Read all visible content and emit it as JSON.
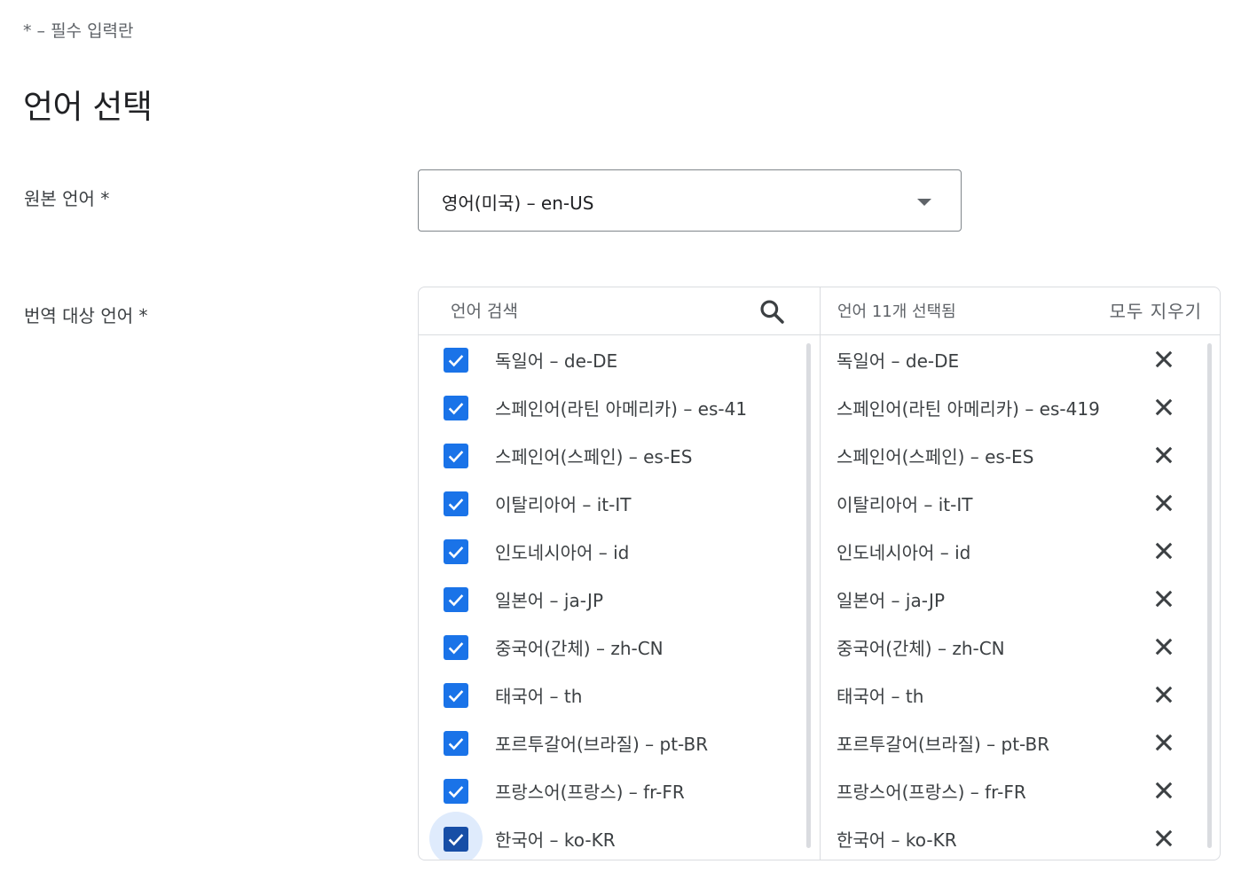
{
  "required_note": "* – 필수 입력란",
  "section_title": "언어 선택",
  "source": {
    "label": "원본 언어 *",
    "value": "영어(미국) – en-US"
  },
  "target": {
    "label": "번역 대상 언어 *",
    "search_placeholder": "언어 검색",
    "selected_count": "언어 11개 선택됨",
    "clear_all": "모두 지우기",
    "options": [
      {
        "label": "독일어 – de-DE",
        "checked": true
      },
      {
        "label": "스페인어(라틴 아메리카) – es-41",
        "checked": true
      },
      {
        "label": "스페인어(스페인) – es-ES",
        "checked": true
      },
      {
        "label": "이탈리아어 – it-IT",
        "checked": true
      },
      {
        "label": "인도네시아어 – id",
        "checked": true
      },
      {
        "label": "일본어 – ja-JP",
        "checked": true
      },
      {
        "label": "중국어(간체) – zh-CN",
        "checked": true
      },
      {
        "label": "태국어 – th",
        "checked": true
      },
      {
        "label": "포르투갈어(브라질) – pt-BR",
        "checked": true
      },
      {
        "label": "프랑스어(프랑스) – fr-FR",
        "checked": true
      },
      {
        "label": "한국어 – ko-KR",
        "checked": true
      }
    ],
    "selected": [
      {
        "label": "독일어 – de-DE"
      },
      {
        "label": "스페인어(라틴 아메리카) – es-419"
      },
      {
        "label": "스페인어(스페인) – es-ES"
      },
      {
        "label": "이탈리아어 – it-IT"
      },
      {
        "label": "인도네시아어 – id"
      },
      {
        "label": "일본어 – ja-JP"
      },
      {
        "label": "중국어(간체) – zh-CN"
      },
      {
        "label": "태국어 – th"
      },
      {
        "label": "포르투갈어(브라질) – pt-BR"
      },
      {
        "label": "프랑스어(프랑스) – fr-FR"
      },
      {
        "label": "한국어 – ko-KR"
      }
    ]
  },
  "colors": {
    "accent": "#1a73e8",
    "accent_focused": "#174ea6",
    "border": "#dadce0",
    "text_secondary": "#5f6368"
  },
  "icons": {
    "search": "search-icon",
    "dropdown": "chevron-down-icon",
    "checkbox": "check-icon",
    "remove": "close-icon"
  }
}
